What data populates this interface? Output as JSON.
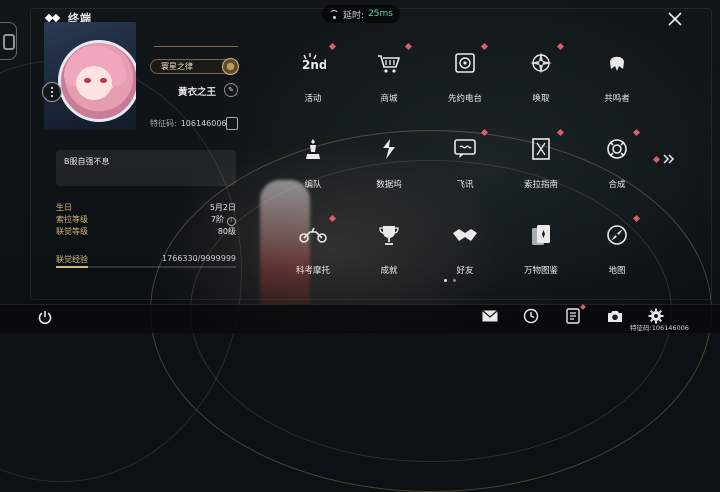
{
  "header": {
    "title": "终端",
    "latency_label": "延时:",
    "latency_value": "25ms",
    "title_icon": "terminal-diamond-icon",
    "close_icon": "close-x-icon"
  },
  "profile": {
    "rank_title": "寰星之律",
    "nickname": "黄衣之王",
    "uid_label": "特征码:",
    "uid": "106146006",
    "signature": "B服自强不息",
    "stats": [
      {
        "label": "生日",
        "value": "5月2日"
      },
      {
        "label": "索拉等级",
        "value": "7阶"
      },
      {
        "label": "联觉等级",
        "value": "80级"
      }
    ],
    "exp_label": "联觉经验",
    "exp_value": "1766330/9999999",
    "exp_fraction": 0.1766
  },
  "menu": {
    "items": [
      {
        "label": "活动",
        "icon": "event-2nd-anniv-icon",
        "badge": true
      },
      {
        "label": "商城",
        "icon": "shop-cart-icon",
        "badge": true
      },
      {
        "label": "先约电台",
        "icon": "radio-icon",
        "badge": true
      },
      {
        "label": "唤取",
        "icon": "summon-compass-icon",
        "badge": true
      },
      {
        "label": "共鸣者",
        "icon": "resonator-icon",
        "badge": false
      },
      {
        "label": "编队",
        "icon": "chess-formation-icon",
        "badge": false
      },
      {
        "label": "数据坞",
        "icon": "data-dock-icon",
        "badge": false
      },
      {
        "label": "飞讯",
        "icon": "message-icon",
        "badge": true
      },
      {
        "label": "索拉指南",
        "icon": "guide-book-icon",
        "badge": true
      },
      {
        "label": "合成",
        "icon": "synthesis-icon",
        "badge": true
      },
      {
        "label": "科考摩托",
        "icon": "motorbike-icon",
        "badge": true
      },
      {
        "label": "成就",
        "icon": "trophy-icon",
        "badge": false
      },
      {
        "label": "好友",
        "icon": "handshake-icon",
        "badge": false
      },
      {
        "label": "万物图鉴",
        "icon": "cards-archive-icon",
        "badge": false
      },
      {
        "label": "地图",
        "icon": "map-compass-icon",
        "badge": true
      }
    ],
    "page_count": 2,
    "current_page": 1
  },
  "footer": {
    "uid_label": "特征码:",
    "uid": "106146006",
    "buttons": [
      "power-icon",
      "mail-icon",
      "clock-icon",
      "notes-icon",
      "camera-icon",
      "settings-gear-icon"
    ]
  },
  "colors": {
    "accent_gold": "#d8b87a",
    "badge_red": "#e05c6a",
    "latency_green": "#5bd6a0"
  }
}
